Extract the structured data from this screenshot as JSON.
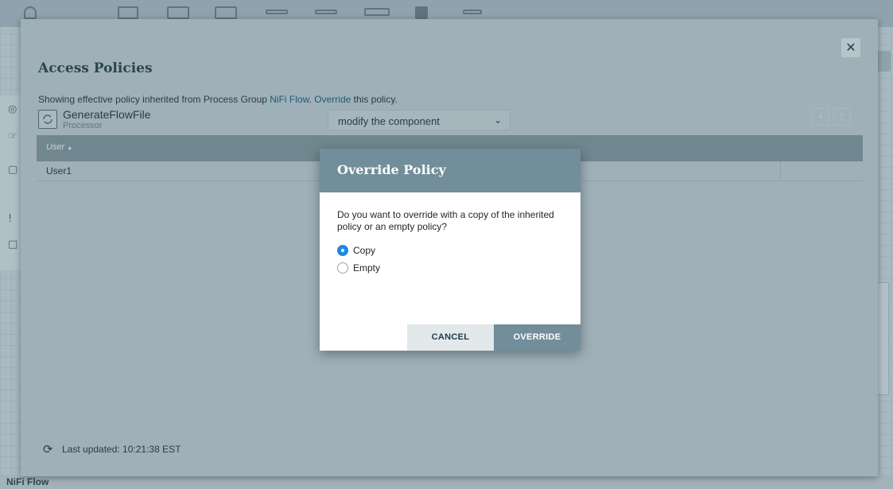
{
  "background": {
    "breadcrumb": "NiFi Flow",
    "toolbar_icons": [
      "processor-icon",
      "input-port-icon",
      "output-port-icon",
      "process-group-icon",
      "remote-group-icon",
      "funnel-icon",
      "template-icon",
      "label-icon"
    ]
  },
  "policies_dialog": {
    "title": "Access Policies",
    "close_label": "✕",
    "inherit_message": {
      "prefix": "Showing effective policy inherited from Process Group ",
      "group_link": "NiFi Flow",
      "middle": ". ",
      "override_link": "Override",
      "suffix": " this policy."
    },
    "component": {
      "name": "GenerateFlowFile",
      "type": "Processor"
    },
    "policy_select": {
      "value": "modify the component"
    },
    "table": {
      "columns": [
        "User"
      ],
      "sort_indicator": "▲",
      "rows": [
        {
          "user": "User1"
        }
      ]
    },
    "last_updated": "Last updated: 10:21:38 EST"
  },
  "override_modal": {
    "title": "Override Policy",
    "question": "Do you want to override with a copy of the inherited policy or an empty policy?",
    "options": [
      {
        "label": "Copy",
        "selected": true
      },
      {
        "label": "Empty",
        "selected": false
      }
    ],
    "cancel_label": "CANCEL",
    "override_label": "OVERRIDE"
  },
  "colors": {
    "modal_header": "#728e9b",
    "radio_selected": "#1e88e5"
  }
}
